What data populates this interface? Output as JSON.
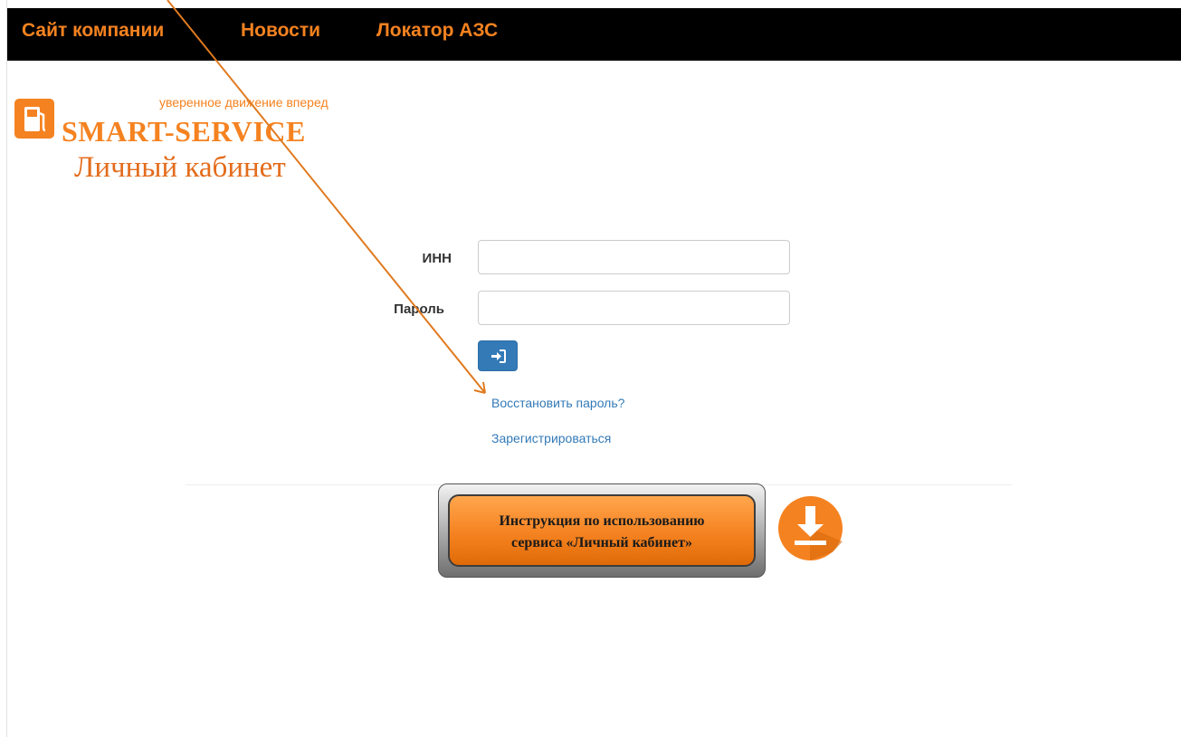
{
  "nav": {
    "items": [
      {
        "label": "Сайт компании"
      },
      {
        "label": "Новости"
      },
      {
        "label": "Локатор АЗС"
      }
    ]
  },
  "logo": {
    "tagline": "уверенное движение вперед",
    "brand": "SMART-SERVICE",
    "subtitle": "Личный кабинет"
  },
  "form": {
    "inn_label": "ИНН",
    "inn_value": "",
    "password_label": "Пароль",
    "password_value": "",
    "login_icon": "sign-in-icon"
  },
  "links": {
    "restore": "Восстановить пароль?",
    "register": "Зарегистрироваться"
  },
  "instruction": {
    "line1": "Инструкция по использованию",
    "line2": "сервиса «Личный кабинет»",
    "icon": "download-icon"
  },
  "colors": {
    "accent": "#f58220",
    "link": "#337ab7",
    "topbar": "#000000"
  }
}
